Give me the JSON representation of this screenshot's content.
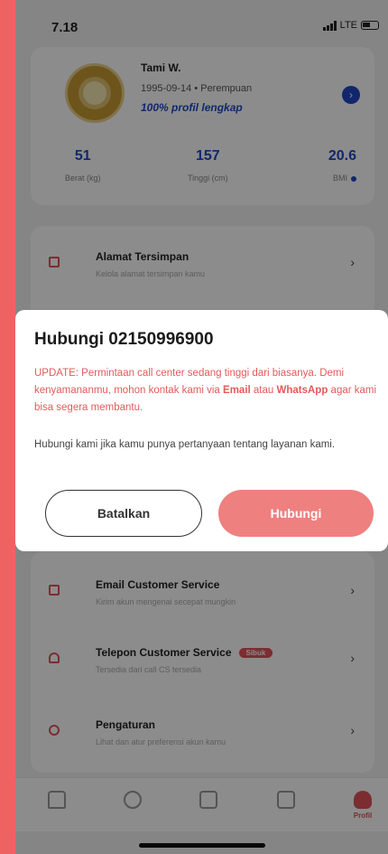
{
  "status_bar": {
    "time": "7.18",
    "network": "LTE"
  },
  "profile": {
    "name": "Tami W.",
    "meta": "1995-09-14 • Perempuan",
    "completeness": "100% profil lengkap",
    "stats": [
      {
        "value": "51",
        "label": "Berat (kg)"
      },
      {
        "value": "157",
        "label": "Tinggi (cm)"
      },
      {
        "value": "20.6",
        "label": "BMI"
      }
    ]
  },
  "menu": {
    "saved_address": {
      "title": "Alamat Tersimpan",
      "subtitle": "Kelola alamat tersimpan kamu"
    },
    "email_cs": {
      "title": "Email Customer Service",
      "subtitle": "Kirim akun mengenai secepat mungkin"
    },
    "phone_cs": {
      "title": "Telepon Customer Service",
      "badge": "Sibuk",
      "subtitle": "Tersedia dari call CS tersedia"
    },
    "settings": {
      "title": "Pengaturan",
      "subtitle": "Lihat dan atur preferensi akun kamu"
    }
  },
  "bottom_nav": {
    "profile_label": "Profil"
  },
  "dialog": {
    "title": "Hubungi 02150996900",
    "warning_start": "UPDATE: Permintaan call center sedang tinggi dari biasanya. Demi kenyamananmu, mohon kontak kami via ",
    "warning_email": "Email",
    "warning_mid": " atau ",
    "warning_whatsapp": "WhatsApp",
    "warning_end": " agar kami bisa segera membantu.",
    "description": "Hubungi kami jika kamu punya pertanyaan tentang layanan kami.",
    "cancel_label": "Batalkan",
    "call_label": "Hubungi"
  },
  "colors": {
    "accent": "#e0525c",
    "primary_blue": "#1f48c7",
    "call_button": "#ef8080",
    "frame": "#ef6262"
  }
}
